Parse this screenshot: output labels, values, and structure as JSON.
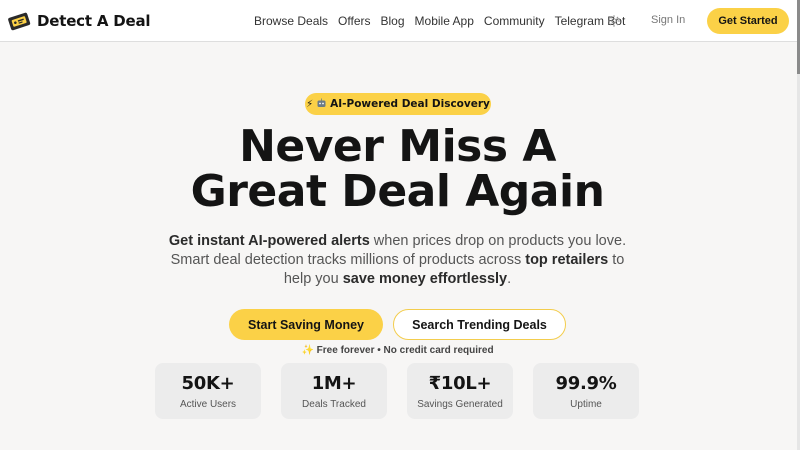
{
  "nav": {
    "brand": "Detect A Deal",
    "brand_icon": "ticket-deal-icon",
    "links": [
      "Browse Deals",
      "Offers",
      "Blog",
      "Mobile App",
      "Community",
      "Telegram Bot"
    ],
    "theme_icon": "sun-icon",
    "sign_in": "Sign In",
    "get_started": "Get Started"
  },
  "hero": {
    "badge_text": "AI-Powered Deal Discovery",
    "badge_icons": [
      "lightning-icon",
      "robot-icon"
    ],
    "headline_line1": "Never Miss A",
    "headline_line2": "Great Deal Again",
    "sub_part1": "Get instant AI-powered alerts",
    "sub_part2": " when prices drop on products you love. Smart deal detection tracks millions of products across ",
    "sub_part3": "top retailers",
    "sub_part4": " to help you ",
    "sub_part5": "save money effortlessly",
    "sub_part6": ".",
    "cta_primary": "Start Saving Money",
    "cta_secondary": "Search Trending Deals",
    "note": "✨ Free forever • No credit card required"
  },
  "stats": [
    {
      "value": "50K+",
      "label": "Active Users"
    },
    {
      "value": "1M+",
      "label": "Deals Tracked"
    },
    {
      "value": "₹10L+",
      "label": "Savings Generated"
    },
    {
      "value": "99.9%",
      "label": "Uptime"
    }
  ],
  "colors": {
    "accent": "#fbd147",
    "background": "#f7f6f5",
    "text": "#141414"
  }
}
